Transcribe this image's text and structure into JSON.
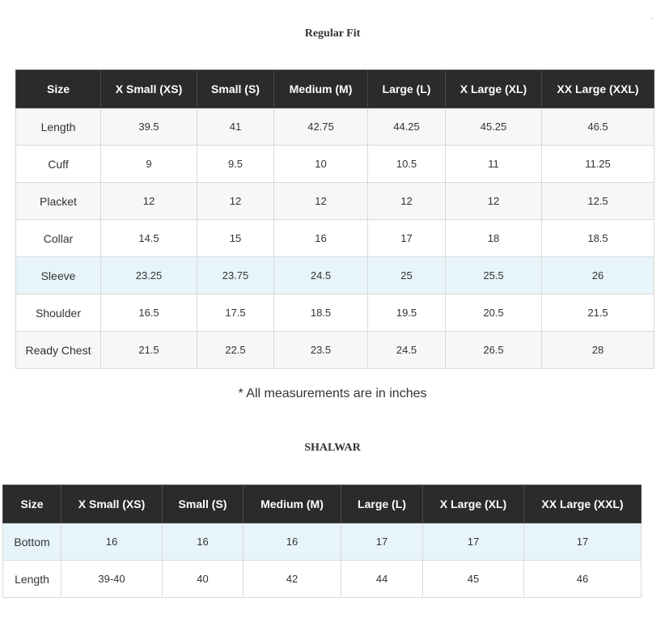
{
  "regular_fit": {
    "title": "Regular Fit",
    "headers": [
      "Size",
      "X Small (XS)",
      "Small (S)",
      "Medium (M)",
      "Large (L)",
      "X Large (XL)",
      "XX Large (XXL)"
    ],
    "rows": [
      {
        "label": "Length",
        "values": [
          "39.5",
          "41",
          "42.75",
          "44.25",
          "45.25",
          "46.5"
        ]
      },
      {
        "label": "Cuff",
        "values": [
          "9",
          "9.5",
          "10",
          "10.5",
          "11",
          "11.25"
        ]
      },
      {
        "label": "Placket",
        "values": [
          "12",
          "12",
          "12",
          "12",
          "12",
          "12.5"
        ]
      },
      {
        "label": "Collar",
        "values": [
          "14.5",
          "15",
          "16",
          "17",
          "18",
          "18.5"
        ]
      },
      {
        "label": "Sleeve",
        "values": [
          "23.25",
          "23.75",
          "24.5",
          "25",
          "25.5",
          "26"
        ]
      },
      {
        "label": "Shoulder",
        "values": [
          "16.5",
          "17.5",
          "18.5",
          "19.5",
          "20.5",
          "21.5"
        ]
      },
      {
        "label": "Ready Chest",
        "values": [
          "21.5",
          "22.5",
          "23.5",
          "24.5",
          "26.5",
          "28"
        ]
      }
    ],
    "note": "* All measurements are in inches"
  },
  "shalwar": {
    "title": "SHALWAR",
    "headers": [
      "Size",
      "X Small (XS)",
      "Small (S)",
      "Medium (M)",
      "Large (L)",
      "X Large (XL)",
      "XX Large (XXL)"
    ],
    "rows": [
      {
        "label": "Bottom",
        "values": [
          "16",
          "16",
          "16",
          "17",
          "17",
          "17"
        ]
      },
      {
        "label": "Length",
        "values": [
          "39-40",
          "40",
          "42",
          "44",
          "45",
          "46"
        ]
      }
    ]
  },
  "colors": {
    "header_bg": "#2b2b2b",
    "highlight_row": "#e7f5fb",
    "alt_row": "#f7f7f7"
  }
}
